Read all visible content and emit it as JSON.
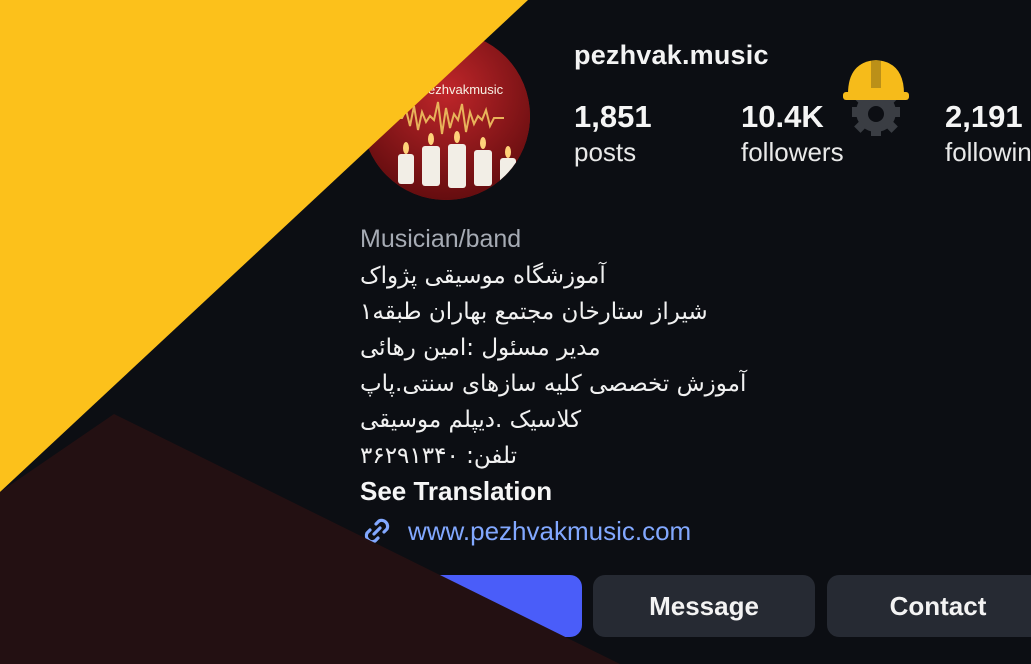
{
  "profile": {
    "username": "pezhvak.music",
    "avatar_text": "pezhvakmusic",
    "stats": [
      {
        "value": "1,851",
        "label": "posts"
      },
      {
        "value": "10.4K",
        "label": "followers"
      },
      {
        "value": "2,191",
        "label": "followin"
      }
    ],
    "category": "Musician/band",
    "bio_lines": [
      "آموزشگاه موسیقی پژواک",
      "شیراز ستارخان مجتمع بهاران طبقه۱",
      "مدیر مسئول :امین رهائی",
      "آموزش تخصصی کلیه سازهای سنتی.پاپ",
      "کلاسیک .دیپلم موسیقی",
      "تلفن: ۳۶۲۹۱۳۴۰"
    ],
    "see_translation": "See Translation",
    "website": "www.pezhvakmusic.com"
  },
  "actions": {
    "follow_label": "w",
    "message_label": "Message",
    "contact_label": "Contact"
  },
  "colors": {
    "background": "#0c0e13",
    "overlay_yellow": "#fcc11b",
    "overlay_dark": "#231012",
    "follow_blue": "#4a5df9",
    "link_blue": "#82a8ff",
    "badge_yellow": "#f6bb1a"
  },
  "icons": {
    "badge": "construction-helmet-gear-icon",
    "link": "link-chain-icon"
  }
}
